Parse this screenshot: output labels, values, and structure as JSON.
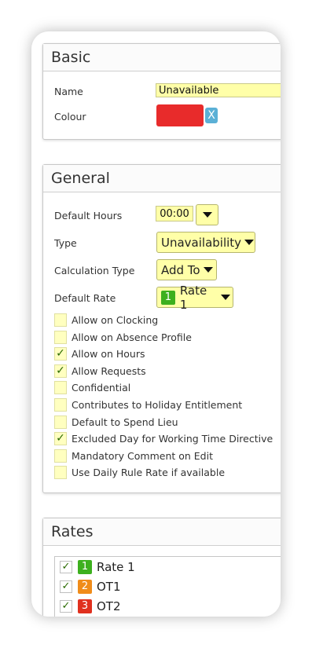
{
  "basic": {
    "title": "Basic",
    "name_label": "Name",
    "name_value": "Unavailable",
    "colour_label": "Colour",
    "colour_value": "#e82b2b",
    "clear_label": "X"
  },
  "general": {
    "title": "General",
    "default_hours_label": "Default Hours",
    "default_hours_value": "00:00",
    "type_label": "Type",
    "type_value": "Unavailability",
    "calc_label": "Calculation Type",
    "calc_value": "Add To",
    "default_rate_label": "Default Rate",
    "default_rate_badge": "1",
    "default_rate_value": "Rate 1",
    "checkboxes": [
      {
        "label": "Allow on Clocking",
        "checked": false
      },
      {
        "label": "Allow on Absence Profile",
        "checked": false
      },
      {
        "label": "Allow on Hours",
        "checked": true
      },
      {
        "label": "Allow Requests",
        "checked": true
      },
      {
        "label": "Confidential",
        "checked": false
      },
      {
        "label": "Contributes to Holiday Entitlement",
        "checked": false
      },
      {
        "label": "Default to Spend Lieu",
        "checked": false
      },
      {
        "label": "Excluded Day for Working Time Directive",
        "checked": true
      },
      {
        "label": "Mandatory Comment on Edit",
        "checked": false
      },
      {
        "label": "Use Daily Rule Rate if available",
        "checked": false
      }
    ]
  },
  "rates": {
    "title": "Rates",
    "items": [
      {
        "badge": "1",
        "label": "Rate 1",
        "color": "#3db01e",
        "checked": true
      },
      {
        "badge": "2",
        "label": "OT1",
        "color": "#f08c1a",
        "checked": true
      },
      {
        "badge": "3",
        "label": "OT2",
        "color": "#e0301e",
        "checked": true
      }
    ]
  },
  "colors": {
    "field_bg": "#ffffa8",
    "clear_btn": "#5bb0d6",
    "check": "#2a6a00"
  }
}
